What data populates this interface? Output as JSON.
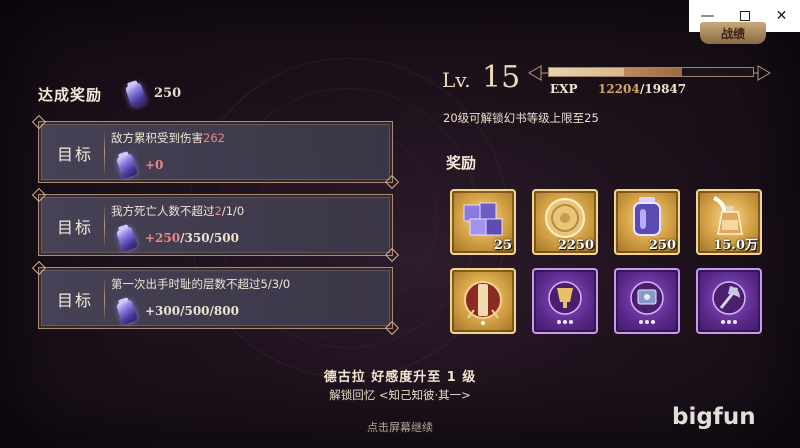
{
  "window_controls": {
    "minimize": "—",
    "maximize": "",
    "close": "✕"
  },
  "top_tab": {
    "label": "战绩"
  },
  "left_panel": {
    "title": "达成奖励",
    "total_reward": "250",
    "goals": [
      {
        "label": "目标",
        "text_prefix": "敌方累积受到伤害",
        "text_highlight": "262",
        "text_suffix": "",
        "reward_highlight": "+0",
        "reward_rest": ""
      },
      {
        "label": "目标",
        "text_prefix": "我方死亡人数不超过",
        "text_highlight": "2",
        "text_suffix": "/1/0",
        "reward_highlight": "+250",
        "reward_rest": "/350/500"
      },
      {
        "label": "目标",
        "text_prefix": "第一次出手时耻的层数不超过5/3/0",
        "text_highlight": "",
        "text_suffix": "",
        "reward_highlight": "",
        "reward_rest": "+300/500/800"
      }
    ]
  },
  "right_panel": {
    "level_label": "Lv.",
    "level_value": "15",
    "exp_label": "EXP",
    "exp_current": "12204",
    "exp_max": "/19847",
    "exp_progress_fraction": 0.37,
    "exp_pending_fraction": 0.28,
    "unlock_note": "20级可解锁幻书等级上限至25",
    "rewards_heading": "奖励",
    "items": [
      {
        "icon": "purple-cubes-icon",
        "rarity": "gold",
        "qty": "25"
      },
      {
        "icon": "gold-coin-icon",
        "rarity": "gold",
        "qty": "2250"
      },
      {
        "icon": "lantern-crystal-icon",
        "rarity": "gold",
        "qty": "250"
      },
      {
        "icon": "potion-feather-icon",
        "rarity": "gold",
        "qty": "15.0万"
      },
      {
        "icon": "scroll-emblem-icon",
        "rarity": "gold",
        "qty": ""
      },
      {
        "icon": "trophy-emblem-icon",
        "rarity": "purple",
        "qty": ""
      },
      {
        "icon": "tome-emblem-icon",
        "rarity": "purple",
        "qty": ""
      },
      {
        "icon": "axe-emblem-icon",
        "rarity": "purple",
        "qty": ""
      }
    ]
  },
  "footer": {
    "affinity_text": "德古拉 好感度升至 1 级",
    "memory_text": "解锁回忆 <知己知彼·其一>",
    "continue_text": "点击屏幕继续"
  },
  "watermark": {
    "text": "bigfun"
  }
}
